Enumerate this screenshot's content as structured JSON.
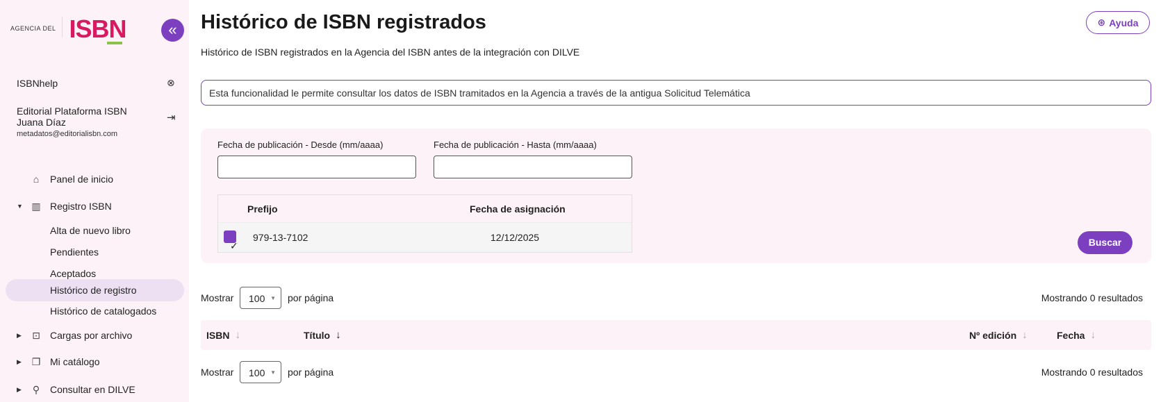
{
  "sidebar": {
    "logo_small": "AGENCIA DEL",
    "logo_big": "ISBN",
    "collapse_icon": "«",
    "help_link": "ISBNhelp",
    "help_icon": "⊗",
    "user": {
      "company": "Editorial Plataforma ISBN",
      "name": "Juana Díaz",
      "email": "metadatos@editorialisbn.com",
      "logout_icon": "⇥"
    },
    "nav": [
      {
        "label": "Panel de inicio",
        "icon": "home-icon",
        "glyph": "⌂"
      },
      {
        "label": "Registro ISBN",
        "icon": "barcode-icon",
        "glyph": "▥",
        "expanded": true
      },
      {
        "label": "Alta de nuevo libro"
      },
      {
        "label": "Pendientes"
      },
      {
        "label": "Aceptados"
      },
      {
        "label": "Histórico de registro",
        "active": true
      },
      {
        "label": "Histórico de catalogados"
      },
      {
        "label": "Cargas por archivo",
        "icon": "upload-icon",
        "glyph": "⊡"
      },
      {
        "label": "Mi catálogo",
        "icon": "catalog-icon",
        "glyph": "❐"
      },
      {
        "label": "Consultar en DILVE",
        "icon": "search-icon",
        "glyph": "⚲"
      }
    ]
  },
  "header": {
    "title": "Histórico de ISBN registrados",
    "subtitle": "Histórico de ISBN registrados en la Agencia del ISBN antes de la integración con DILVE",
    "help_button": "Ayuda",
    "help_icon": "⊛"
  },
  "info_box": "Esta funcionalidad le permite consultar los datos de ISBN tramitados en la Agencia a través de la antigua Solicitud Telemática",
  "filters": {
    "from_label": "Fecha de publicación - Desde (mm/aaaa)",
    "from_value": "",
    "to_label": "Fecha de publicación - Hasta (mm/aaaa)",
    "to_value": "",
    "prefix_table": {
      "headers": [
        "Prefijo",
        "Fecha de asignación"
      ],
      "rows": [
        {
          "checked": true,
          "prefix": "979-13-7102",
          "date": "12/12/2025"
        }
      ]
    },
    "search_button": "Buscar"
  },
  "pager": {
    "show_label": "Mostrar",
    "per_page_value": "100",
    "per_page_label": "por página",
    "results_text": "Mostrando 0 resultados"
  },
  "results_table": {
    "columns": [
      {
        "label": "ISBN",
        "sort": "none"
      },
      {
        "label": "Título",
        "sort": "desc"
      },
      {
        "label": "Nº edición",
        "sort": "none"
      },
      {
        "label": "Fecha",
        "sort": "none"
      }
    ]
  },
  "colors": {
    "accent": "#7b3fbf",
    "brand": "#d81b60",
    "panel_bg": "#fdf2f7",
    "active_nav": "#ede0f3"
  }
}
